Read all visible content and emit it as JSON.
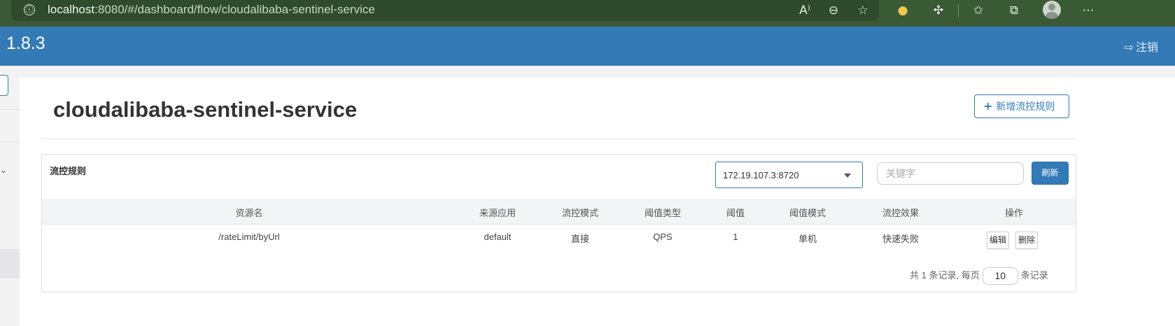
{
  "browser": {
    "url_host": "localhost",
    "url_rest": ":8080/#/dashboard/flow/cloudalibaba-sentinel-service",
    "info_icon": "ⓘ",
    "toolbar_icons": [
      "read-aloud-icon",
      "zoom-out-icon",
      "favorite-add-icon",
      "color-extension-icon",
      "extensions-icon",
      "favorites-icon",
      "collections-icon",
      "profile-avatar",
      "more-icon"
    ]
  },
  "header": {
    "version": "1.8.3",
    "logout_label": "注销",
    "color": "#337ab7"
  },
  "page": {
    "title": "cloudalibaba-sentinel-service",
    "add_rule_label": "新增流控规则"
  },
  "panel": {
    "title": "流控规则",
    "machine_selected": "172.19.107.3:8720",
    "keyword_placeholder": "关键字",
    "refresh_label": "刷新"
  },
  "table": {
    "columns": [
      "资源名",
      "来源应用",
      "流控模式",
      "阈值类型",
      "阈值",
      "阈值模式",
      "流控效果",
      "操作"
    ],
    "rows": [
      {
        "resource": "/rateLimit/byUrl",
        "origin": "default",
        "mode": "直接",
        "threshold_type": "QPS",
        "threshold": "1",
        "cluster_mode": "单机",
        "effect": "快速失败",
        "edit_label": "编辑",
        "delete_label": "删除"
      }
    ]
  },
  "pagination": {
    "prefix": "共",
    "total": "1",
    "middle": "条记录, 每页",
    "page_size": "10",
    "suffix": "条记录"
  }
}
